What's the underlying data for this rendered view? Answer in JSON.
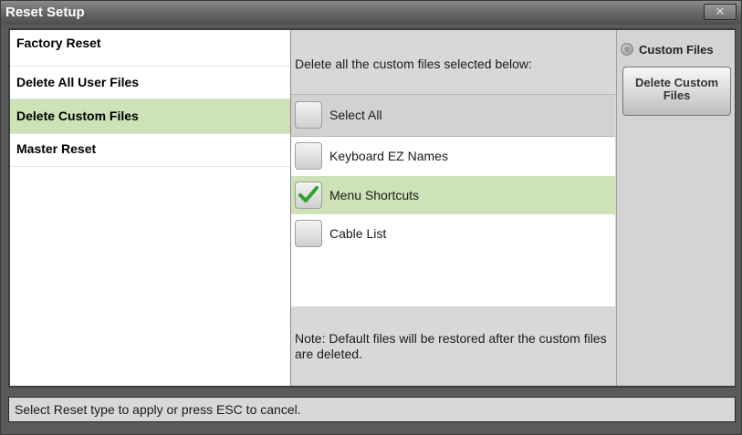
{
  "window": {
    "title": "Reset Setup",
    "close_glyph": "✕"
  },
  "reset_types": [
    {
      "label": "Factory Reset",
      "selected": false
    },
    {
      "label": "Delete All User Files",
      "selected": false
    },
    {
      "label": "Delete Custom Files",
      "selected": true
    },
    {
      "label": "Master Reset",
      "selected": false
    }
  ],
  "files_panel": {
    "instruction": "Delete all the custom files selected below:",
    "select_all": {
      "label": "Select All",
      "checked": false
    },
    "items": [
      {
        "label": "Keyboard EZ Names",
        "checked": false
      },
      {
        "label": "Menu Shortcuts",
        "checked": true
      },
      {
        "label": "Cable List",
        "checked": false
      }
    ],
    "note": "Note: Default files will be restored after the custom files are deleted."
  },
  "actions": {
    "radio_label": "Custom Files",
    "delete_button": "Delete Custom Files"
  },
  "status": {
    "text": "Select Reset type to apply or press ESC to cancel."
  },
  "colors": {
    "selection": "#cde2b7",
    "check": "#2ea22e"
  }
}
